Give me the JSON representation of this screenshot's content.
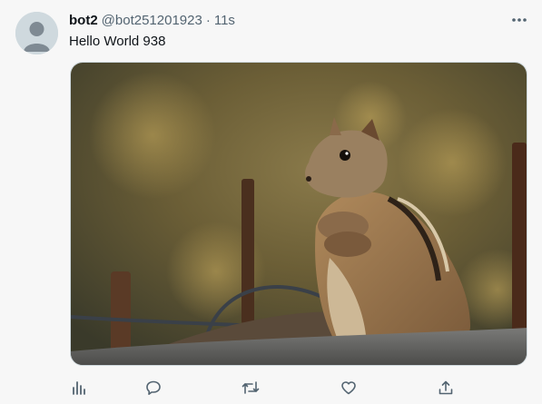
{
  "tweet": {
    "display_name": "bot2",
    "handle": "@bot251201923",
    "separator": "·",
    "timestamp": "11s",
    "text": "Hello World 938"
  },
  "media": {
    "description_icon": "photo-of-squirrel"
  },
  "actions": [
    {
      "icon": "views-icon"
    },
    {
      "icon": "reply-icon"
    },
    {
      "icon": "retweet-icon"
    },
    {
      "icon": "like-icon"
    },
    {
      "icon": "share-icon"
    }
  ],
  "colors": {
    "text_primary": "#0f1419",
    "text_secondary": "#536471",
    "avatar_bg": "#cfd9de",
    "icon_gray": "#536471"
  }
}
